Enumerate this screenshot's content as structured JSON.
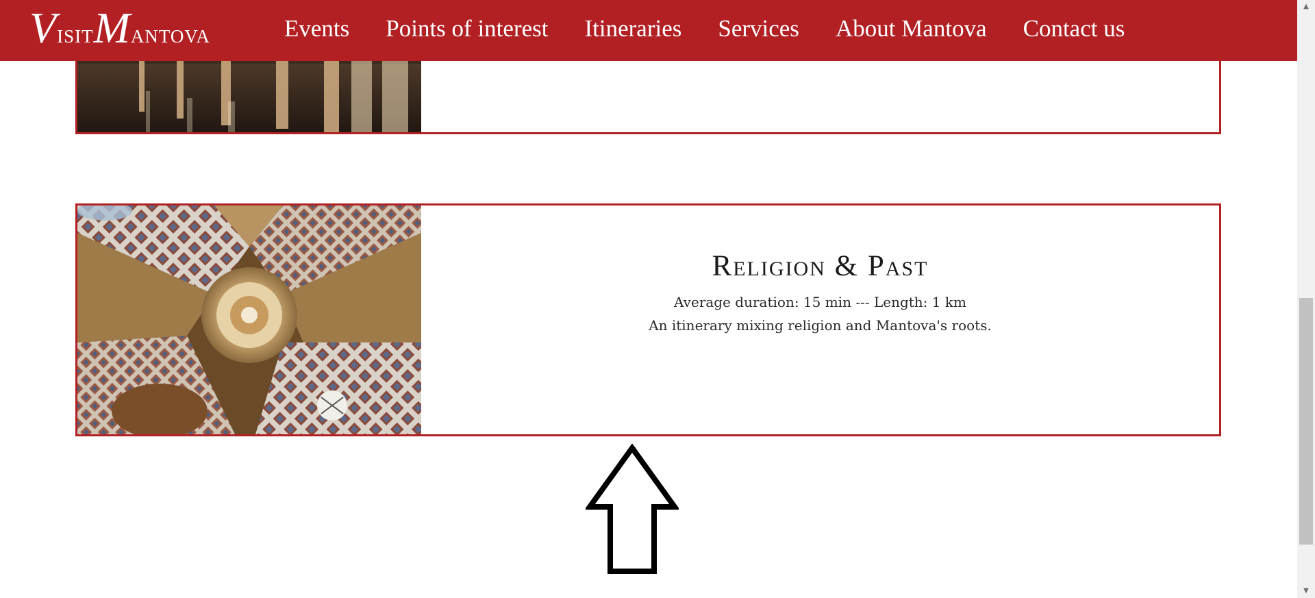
{
  "brand": {
    "logo_v": "V",
    "logo_isit": "isit",
    "logo_m": "M",
    "logo_antova": "antova",
    "color": "#b22024"
  },
  "nav": {
    "items": [
      {
        "label": "Events"
      },
      {
        "label": "Points of interest"
      },
      {
        "label": "Itineraries"
      },
      {
        "label": "Services"
      },
      {
        "label": "About Mantova"
      },
      {
        "label": "Contact us"
      }
    ]
  },
  "cards": [
    {
      "image": "underground-arcade-photo"
    },
    {
      "image": "basilica-dome-ceiling-photo",
      "title": "Religion & Past",
      "meta": "Average duration: 15 min --- Length: 1 km",
      "description": "An itinerary mixing religion and Mantova's roots."
    }
  ],
  "scroll_arrow_icon": "up-arrow-icon",
  "scrollbar": {
    "up_glyph": "▲",
    "down_glyph": "▼"
  }
}
